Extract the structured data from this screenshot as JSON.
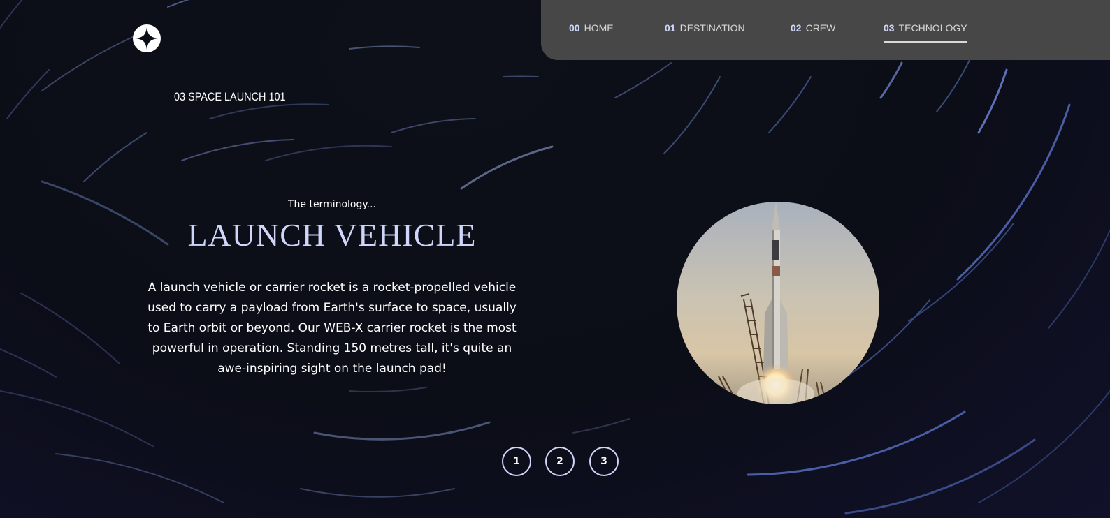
{
  "logo": {
    "icon": "star-icon",
    "color": "#ffffff"
  },
  "nav": {
    "items": [
      {
        "num": "00",
        "label": "HOME",
        "active": false
      },
      {
        "num": "01",
        "label": "DESTINATION",
        "active": false
      },
      {
        "num": "02",
        "label": "CREW",
        "active": false
      },
      {
        "num": "03",
        "label": "TECHNOLOGY",
        "active": true
      }
    ]
  },
  "section": {
    "eyebrow": "03 SPACE LAUNCH 101"
  },
  "tech": {
    "kicker": "The terminology...",
    "title": "LAUNCH VEHICLE",
    "description": "A launch vehicle or carrier rocket is a rocket-propelled vehicle used to carry a payload from Earth's surface to space, usually to Earth orbit or beyond. Our WEB-X carrier rocket is the most powerful in operation. Standing 150 metres tall, it's quite an awe-inspiring sight on the launch pad!"
  },
  "pagination": {
    "pages": [
      "1",
      "2",
      "3"
    ],
    "selected": "1"
  },
  "colors": {
    "accent": "#d0d6f9",
    "nav_bg": "#474747",
    "background": "#0b0d17"
  }
}
